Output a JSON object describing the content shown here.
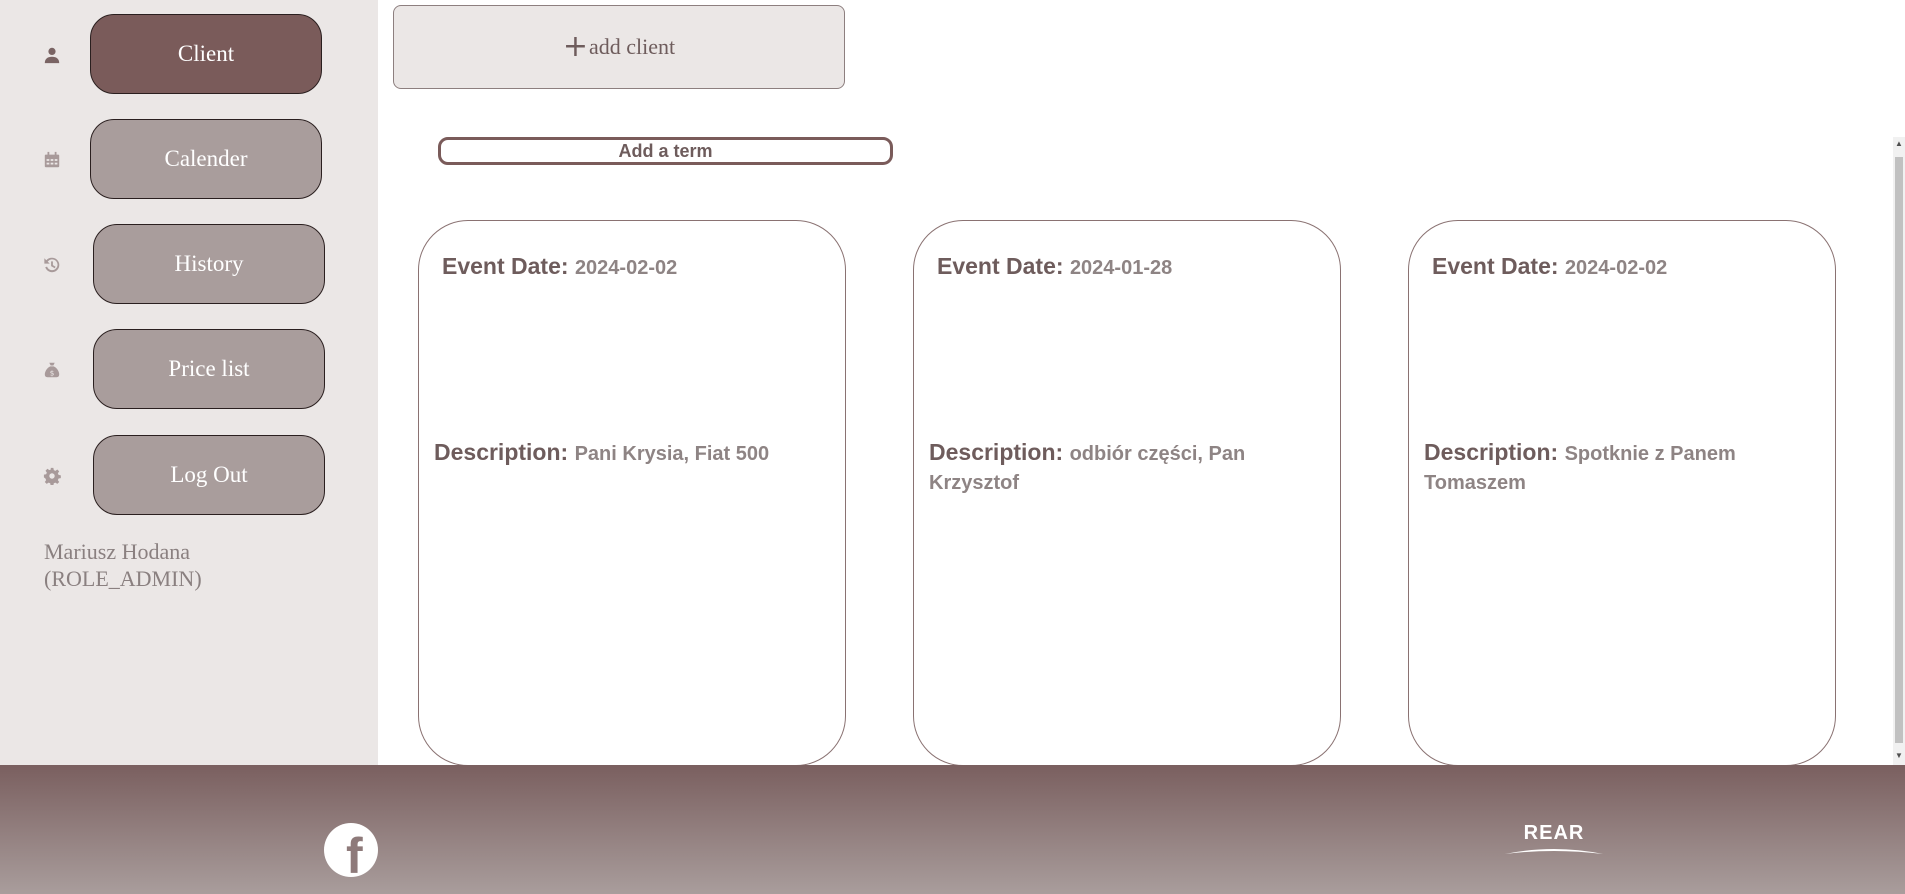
{
  "sidebar": {
    "items": [
      {
        "label": "Client",
        "icon": "user-icon",
        "active": true
      },
      {
        "label": "Calender",
        "icon": "calendar-icon",
        "active": false
      },
      {
        "label": "History",
        "icon": "history-icon",
        "active": false
      },
      {
        "label": "Price list",
        "icon": "money-bag-icon",
        "active": false
      },
      {
        "label": "Log Out",
        "icon": "gear-icon",
        "active": false
      }
    ],
    "user": {
      "name": "Mariusz Hodana",
      "role": "(ROLE_ADMIN)"
    }
  },
  "actions": {
    "add_client": "add client",
    "add_client_icon": "+",
    "add_term": "Add a term"
  },
  "cards": [
    {
      "date_label": "Event Date:",
      "date": "2024-02-02",
      "desc_label": "Description:",
      "desc": "Pani Krysia, Fiat 500"
    },
    {
      "date_label": "Event Date:",
      "date": "2024-01-28",
      "desc_label": "Description:",
      "desc": "odbiór części, Pan Krzysztof"
    },
    {
      "date_label": "Event Date:",
      "date": "2024-02-02",
      "desc_label": "Description:",
      "desc": "Spotknie z Panem Tomaszem"
    }
  ],
  "footer": {
    "facebook_icon": "facebook-icon",
    "logo_text": "REAR"
  },
  "colors": {
    "accent": "#7a5b5a",
    "button": "#a99d9c",
    "sidebar_bg": "#ebe7e6",
    "text": "#6e5c5c"
  }
}
